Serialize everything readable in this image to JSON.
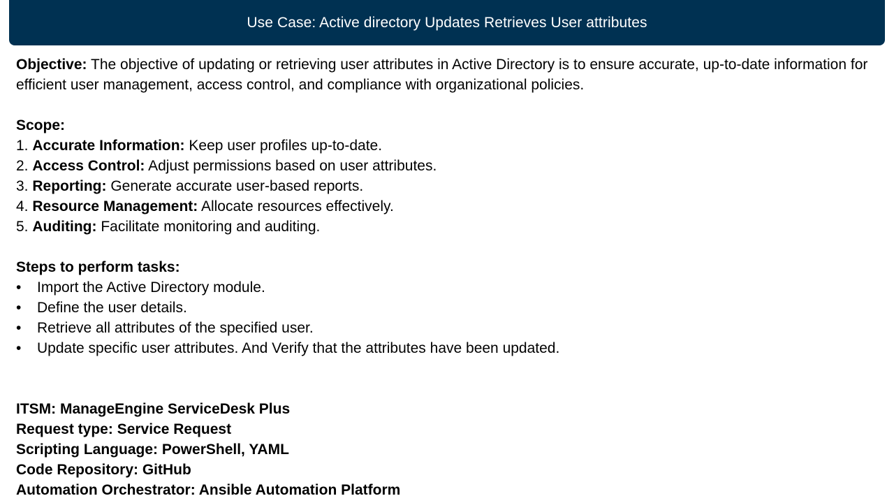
{
  "title": "Use Case: Active directory Updates Retrieves User attributes",
  "objective": {
    "label": "Objective:",
    "text": " The objective of updating or retrieving user attributes in Active Directory is to ensure accurate, up-to-date information for efficient user management, access control, and compliance with organizational policies."
  },
  "scope": {
    "heading": "Scope:",
    "items": [
      {
        "num": "1. ",
        "label": "Accurate Information:",
        "text": " Keep user profiles up-to-date."
      },
      {
        "num": "2. ",
        "label": "Access Control:",
        "text": " Adjust permissions based on user attributes."
      },
      {
        "num": "3. ",
        "label": "Reporting:",
        "text": " Generate accurate user-based reports."
      },
      {
        "num": "4. ",
        "label": "Resource Management:",
        "text": " Allocate resources effectively."
      },
      {
        "num": "5. ",
        "label": "Auditing:",
        "text": " Facilitate monitoring and auditing."
      }
    ]
  },
  "steps": {
    "heading": "Steps to perform tasks:",
    "bullet": "•",
    "items": [
      "Import the Active Directory module.",
      "Define the user details.",
      "Retrieve all attributes of the specified user.",
      "Update specific user attributes. And Verify that the attributes have been updated."
    ]
  },
  "details": [
    "ITSM: ManageEngine ServiceDesk Plus",
    "Request type: Service Request",
    "Scripting Language: PowerShell, YAML",
    "Code Repository: GitHub",
    "Automation Orchestrator: Ansible Automation Platform"
  ]
}
